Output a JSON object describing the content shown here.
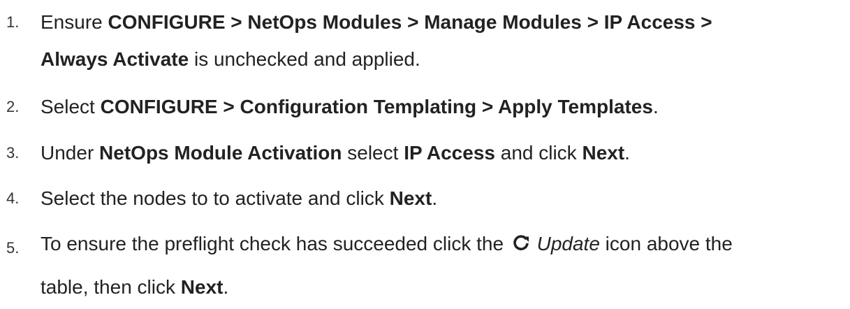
{
  "steps": [
    {
      "number": "1.",
      "line1": {
        "t1": "Ensure ",
        "b1": "CONFIGURE > NetOps Modules > Manage Modules > IP Access >"
      },
      "line2": {
        "b1": "Always Activate",
        "t1": " is unchecked and applied."
      }
    },
    {
      "number": "2.",
      "t1": "Select ",
      "b1": "CONFIGURE > Configuration Templating > Apply Templates",
      "t2": "."
    },
    {
      "number": "3.",
      "t1": "Under ",
      "b1": "NetOps Module Activation",
      "t2": " select ",
      "b2": "IP Access",
      "t3": " and click ",
      "b3": "Next",
      "t4": "."
    },
    {
      "number": "4.",
      "t1": "Select the nodes to to activate and click ",
      "b1": "Next",
      "t2": "."
    },
    {
      "number": "5.",
      "line1": {
        "t1": "To ensure the preflight check has succeeded click the ",
        "icon": "refresh-icon",
        "i1": "Update",
        "t2": " icon above the"
      },
      "line2": {
        "t1": "table, then click ",
        "b1": "Next",
        "t2": "."
      }
    }
  ],
  "colors": {
    "text": "#222222",
    "background": "#ffffff"
  }
}
